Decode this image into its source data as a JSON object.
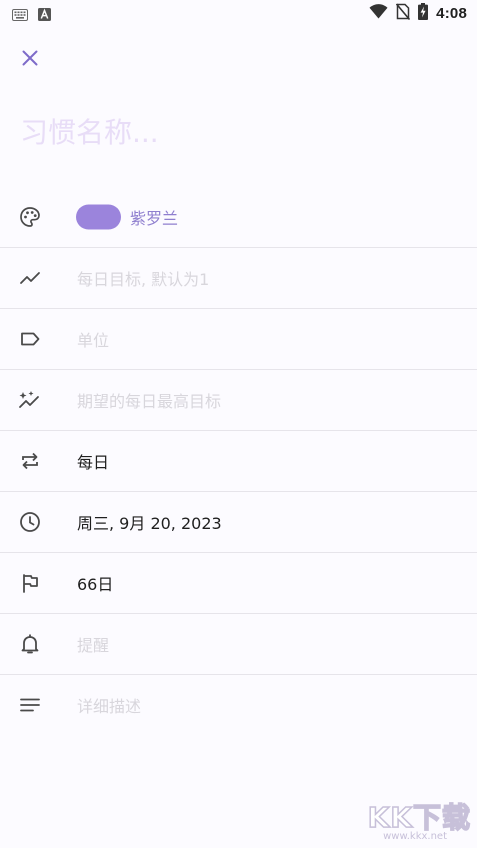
{
  "status_bar": {
    "time": "4:08",
    "left_icons": [
      "keyboard-icon",
      "a-notification-icon"
    ],
    "right_icons": [
      "wifi-icon",
      "no-sim-icon",
      "battery-charging-icon"
    ]
  },
  "header": {
    "close_icon": "close-icon"
  },
  "title_input": {
    "value": "",
    "placeholder": "习惯名称..."
  },
  "fields": {
    "color": {
      "icon": "palette-icon",
      "label": "紫罗兰",
      "color": "#9b84dc"
    },
    "daily_goal": {
      "icon": "trending-icon",
      "placeholder": "每日目标, 默认为1"
    },
    "unit": {
      "icon": "label-icon",
      "placeholder": "单位"
    },
    "max_goal": {
      "icon": "auto-graph-icon",
      "placeholder": "期望的每日最高目标"
    },
    "frequency": {
      "icon": "repeat-icon",
      "value": "每日"
    },
    "start_date": {
      "icon": "clock-icon",
      "value": "周三, 9月 20, 2023"
    },
    "duration": {
      "icon": "flag-icon",
      "value": "66日"
    },
    "reminder": {
      "icon": "bell-icon",
      "placeholder": "提醒"
    },
    "description": {
      "icon": "notes-icon",
      "placeholder": "详细描述"
    }
  },
  "theme": {
    "accent": "#7e6bc9",
    "placeholder_color": "#d8d6dc",
    "title_placeholder_color": "#e8ddf7",
    "divider": "#e6e4ea",
    "background": "#fcfbff",
    "icon_color": "#4a4a4a"
  },
  "watermark": {
    "logo": "KK下载",
    "url": "www.kkx.net"
  }
}
